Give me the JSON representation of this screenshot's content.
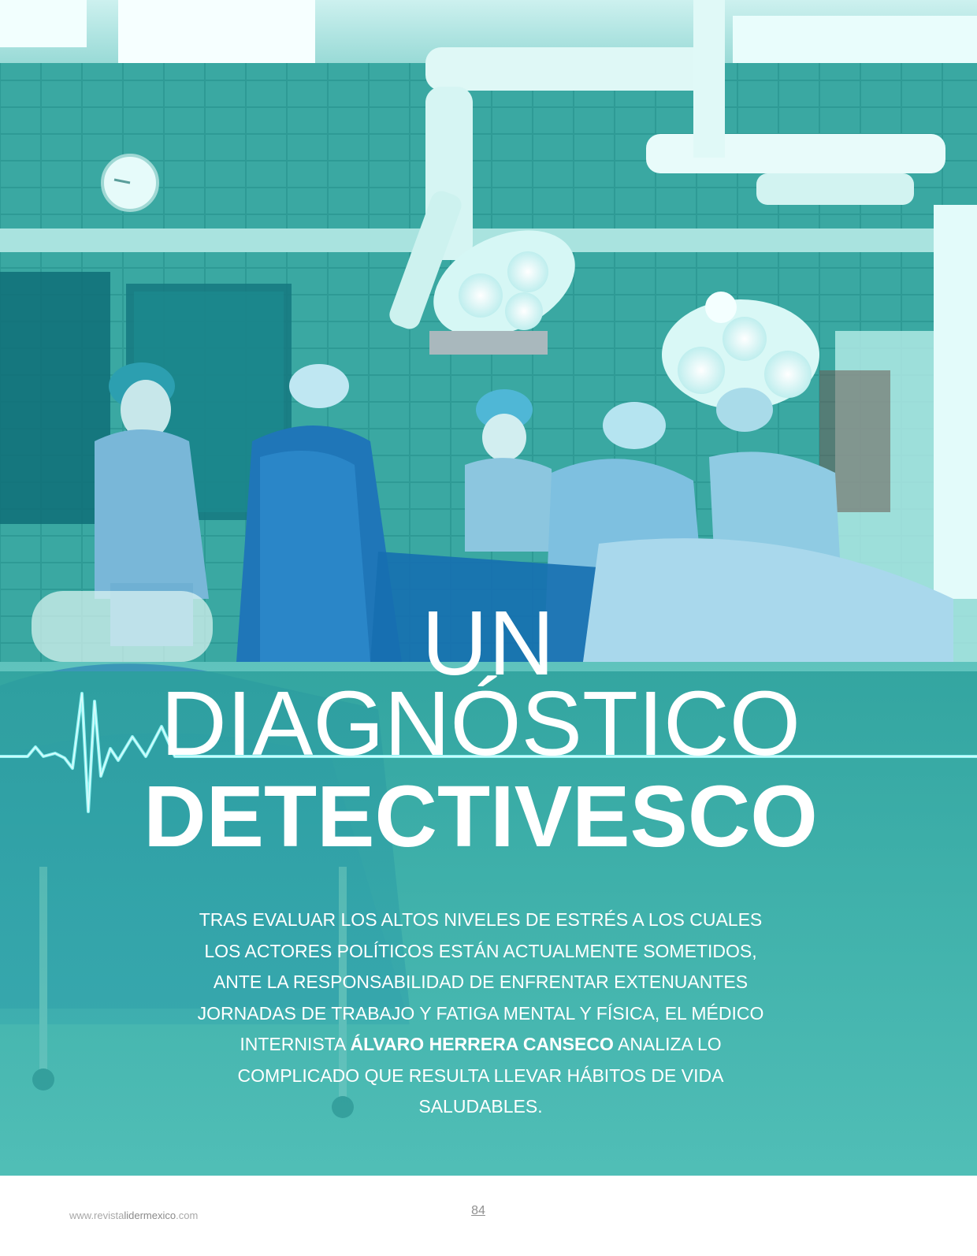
{
  "title": {
    "line1": "UN",
    "line2": "DIAGNÓSTICO",
    "line3": "DETECTIVESCO"
  },
  "lead": {
    "part1": "TRAS EVALUAR LOS ALTOS NIVELES DE ESTRÉS A LOS CUALES LOS ACTORES POLÍTICOS ESTÁN ACTUALMENTE SOMETIDOS, ANTE LA RESPONSABILIDAD DE ENFRENTAR EXTENUANTES JORNADAS DE TRABAJO Y FATIGA MENTAL Y FÍSICA, EL MÉDICO INTERNISTA ",
    "name": "ÁLVARO HERRERA CANSECO",
    "part2": " ANALIZA LO COMPLICADO QUE RESULTA LLEVAR HÁBITOS DE VIDA SALUDABLES."
  },
  "footer": {
    "url_prefix": "www.revista",
    "url_highlight": "lidermexico",
    "url_suffix": ".com",
    "page_number": "84"
  },
  "colors": {
    "tint": "#2ea39f",
    "ecg_line": "#7ff0f2",
    "text": "#ffffff"
  }
}
